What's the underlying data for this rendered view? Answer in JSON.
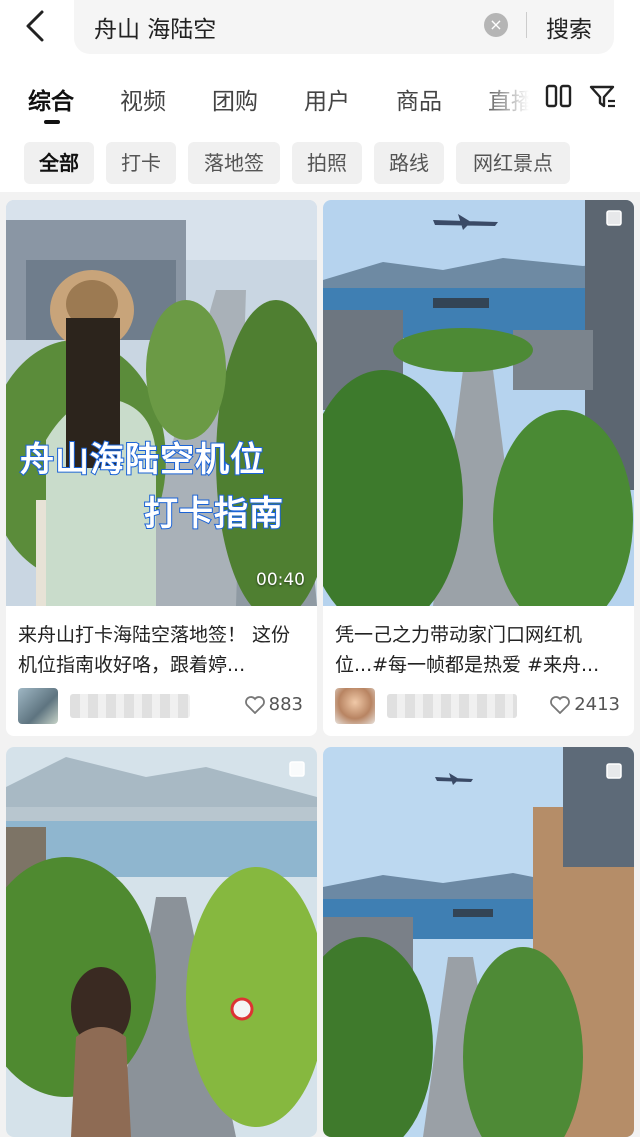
{
  "search": {
    "query": "舟山 海陆空",
    "clear_icon": "×",
    "submit_label": "搜索"
  },
  "tabs": [
    {
      "label": "综合",
      "active": true
    },
    {
      "label": "视频",
      "active": false
    },
    {
      "label": "团购",
      "active": false
    },
    {
      "label": "用户",
      "active": false
    },
    {
      "label": "商品",
      "active": false
    },
    {
      "label": "直播",
      "active": false
    }
  ],
  "tab_icons": [
    "dual-column-icon",
    "filter-icon"
  ],
  "chips": [
    {
      "label": "全部",
      "active": true
    },
    {
      "label": "打卡",
      "active": false
    },
    {
      "label": "落地签",
      "active": false
    },
    {
      "label": "拍照",
      "active": false
    },
    {
      "label": "路线",
      "active": false
    },
    {
      "label": "网红景点",
      "active": false
    }
  ],
  "cards": [
    {
      "type": "video",
      "overlay_line1": "舟山海陆空机位",
      "overlay_line2": "打卡指南",
      "duration": "00:40",
      "title": "来舟山打卡海陆空落地签！ 这份机位指南收好咯，跟着婷...",
      "likes": "883"
    },
    {
      "type": "album",
      "title": "凭一己之力带动家门口网红机位...#每一帧都是热爱 #来舟...",
      "likes": "2413"
    },
    {
      "type": "album"
    },
    {
      "type": "album"
    }
  ],
  "colors": {
    "accent": "#111111",
    "overlay_stroke": "#1b63d6",
    "sky": "#b9d6ef",
    "sea": "#3f7fb3",
    "tree": "#3f7a2e"
  }
}
